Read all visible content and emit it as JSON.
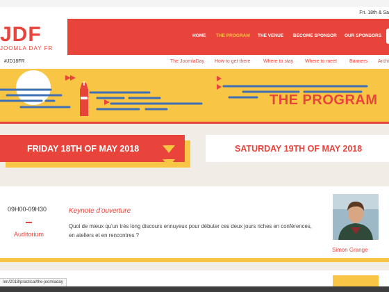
{
  "topbar": {
    "date_text": "Fri. 18th & Sa"
  },
  "logo": {
    "mark": "JDF",
    "subtitle": "JOOMLA DAY FR"
  },
  "main_nav": [
    "HOME",
    "THE PROGRAM",
    "THE VENUE",
    "BECOME SPONSOR",
    "OUR SPONSORS"
  ],
  "main_nav_active": "THE PROGRAM",
  "sub_nav": {
    "hashtag": "#JD18FR",
    "links": [
      "The JoomlaDay",
      "How to get there",
      "Where to stay",
      "Where to meet",
      "Banners",
      "Archi"
    ]
  },
  "banner": {
    "title": "THE PROGRAM"
  },
  "days": [
    "FRIDAY 18TH OF MAY 2018",
    "SATURDAY 19TH OF MAY 2018"
  ],
  "session": {
    "time": "09H00-09H30",
    "room": "Auditorium",
    "title": "Keynote d'ouverture",
    "description": "Quoi de mieux qu'un très long discours ennuyeux pour débuter ces deux jours riches en conférences, en ateliers et en rencontres ?",
    "speaker": "Simon Grange"
  },
  "status_url": "/en/2018/practical/the-joomladay",
  "colors": {
    "red": "#e8443c",
    "yellow": "#f9c544",
    "background": "#f1ece6"
  }
}
